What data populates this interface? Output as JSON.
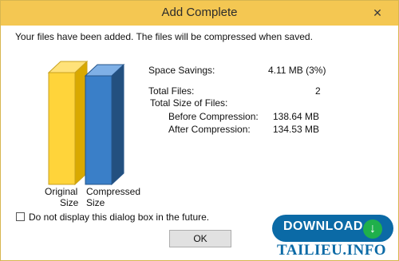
{
  "window": {
    "title": "Add Complete",
    "close_glyph": "✕"
  },
  "message": "Your files have been added.  The files will be compressed when saved.",
  "chart": {
    "bars": [
      {
        "label_line1": "Original",
        "label_line2": "Size",
        "value_mb": 138.64,
        "color": "#ffd43a"
      },
      {
        "label_line1": "Compressed",
        "label_line2": "Size",
        "value_mb": 134.53,
        "color": "#3a7fc8"
      }
    ]
  },
  "stats": {
    "space_savings_label": "Space Savings:",
    "space_savings_value": "4.11 MB (3%)",
    "total_files_label": "Total Files:",
    "total_files_value": "2",
    "total_size_label": "Total Size of Files:",
    "before_label": "Before Compression:",
    "before_value": "138.64 MB",
    "after_label": "After Compression:",
    "after_value": "134.53 MB"
  },
  "checkbox": {
    "label": "Do not display this dialog box in the future.",
    "checked": false
  },
  "ok_button": {
    "label": "OK"
  },
  "watermark": {
    "download_text": "DOWNLOAD",
    "site_text": "TAILIEU.INFO",
    "icon": "download-arrow-icon"
  }
}
